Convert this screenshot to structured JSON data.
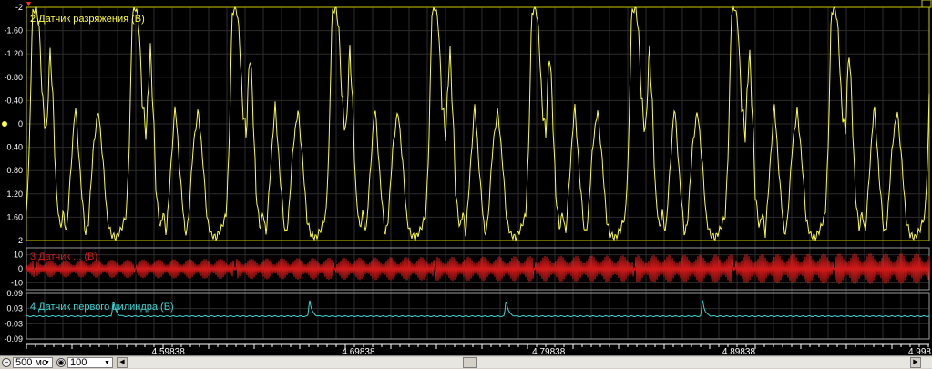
{
  "chart_data": [
    {
      "type": "line",
      "title": "2 Датчик разряжения (В)",
      "series_name": "2 Датчик разряжения (В)",
      "color": "#ffff33",
      "axis_inverted": true,
      "ylim": [
        -2,
        2
      ],
      "yticks": [
        "-2",
        "-1.60",
        "-1.20",
        "-0.80",
        "-0.40",
        "0",
        "0.40",
        "0.80",
        "1.20",
        "1.60",
        "2"
      ],
      "cycle_period_s": 0.0525,
      "first_cycle_start_s": 4.5238,
      "profile": [
        {
          "p": 0.0,
          "v": 1.55
        },
        {
          "p": 0.03,
          "v": 0.4
        },
        {
          "p": 0.06,
          "v": -1.9
        },
        {
          "p": 0.1,
          "v": -2.0
        },
        {
          "p": 0.13,
          "v": -1.6
        },
        {
          "p": 0.16,
          "v": -0.4
        },
        {
          "p": 0.18,
          "v": -0.1
        },
        {
          "p": 0.2,
          "v": 0.2
        },
        {
          "p": 0.22,
          "v": -0.6
        },
        {
          "p": 0.24,
          "v": -1.3
        },
        {
          "p": 0.27,
          "v": -0.2
        },
        {
          "p": 0.3,
          "v": 1.2
        },
        {
          "p": 0.34,
          "v": 1.8
        },
        {
          "p": 0.37,
          "v": 1.5
        },
        {
          "p": 0.4,
          "v": 1.9
        },
        {
          "p": 0.44,
          "v": 0.9
        },
        {
          "p": 0.49,
          "v": -0.35
        },
        {
          "p": 0.54,
          "v": 0.9
        },
        {
          "p": 0.59,
          "v": 1.9
        },
        {
          "p": 0.62,
          "v": 1.7
        },
        {
          "p": 0.67,
          "v": 0.4
        },
        {
          "p": 0.72,
          "v": -0.25
        },
        {
          "p": 0.77,
          "v": 0.7
        },
        {
          "p": 0.81,
          "v": 1.65
        },
        {
          "p": 0.85,
          "v": 1.9
        },
        {
          "p": 0.9,
          "v": 1.95
        },
        {
          "p": 0.95,
          "v": 1.8
        },
        {
          "p": 1.0,
          "v": 1.55
        }
      ]
    },
    {
      "type": "line",
      "title": "3 Датчик ... (В)",
      "color": "#d21a1a",
      "ylim": [
        -15,
        15
      ],
      "yticks": [
        "10",
        "0",
        "-10"
      ],
      "wave": "dense oscillation, amplitude approx 10, growing in later cycles"
    },
    {
      "type": "line",
      "title": "4 Датчик первого цилиндра (В)",
      "series_name": "4 Датчик первого цилиндра (В)",
      "color": "#33d6d6",
      "ylim": [
        -0.09,
        0.09
      ],
      "yticks": [
        "0.09",
        "0.03",
        "-0.03",
        "-0.09"
      ],
      "spike_times_s": [
        4.5695,
        4.6727,
        4.776,
        4.8793
      ],
      "spike_value": 0.068,
      "baseline": 0.0
    }
  ],
  "x_axis": {
    "xlim": [
      4.5238,
      4.9985
    ],
    "ticks": [
      4.59838,
      4.69838,
      4.79838,
      4.89838
    ],
    "tick_labels": [
      "4.59838",
      "4.69838",
      "4.79838",
      "4.89838",
      "4.998"
    ]
  },
  "labels": {
    "trace1": "2 Датчик разряжения (В)",
    "trace2": "3 Датчик ... (В)",
    "trace3": "4 Датчик первого цилиндра (В)"
  },
  "toolbar": {
    "timebase": "500 мс",
    "zoom": "100"
  },
  "colors": {
    "background": "#000000",
    "grid": "#2c2c2c",
    "axis_text": "#ffffff",
    "border": "#ffffff",
    "trace1": "#ffff33",
    "trace2": "#d21a1a",
    "trace3": "#33d6d6"
  }
}
